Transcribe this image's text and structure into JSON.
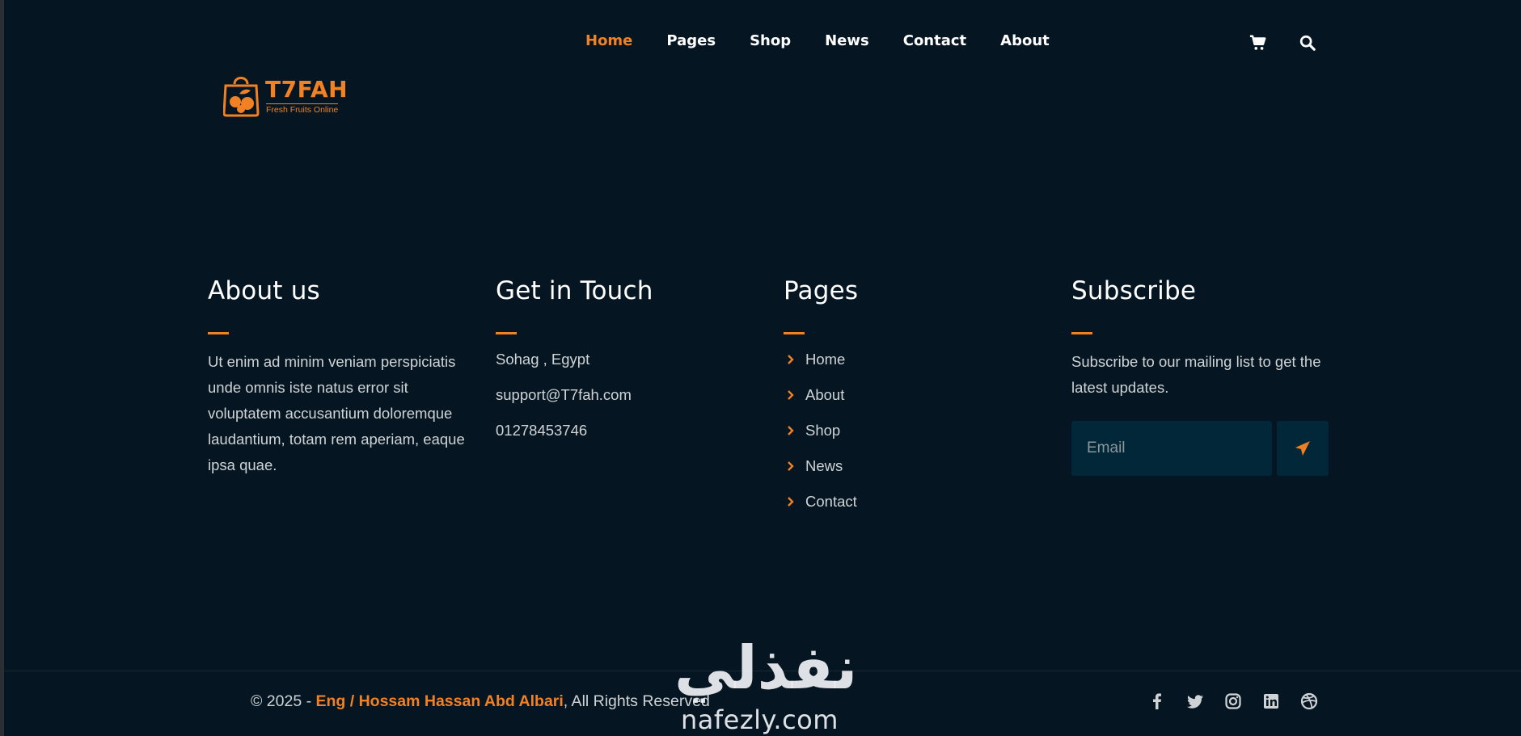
{
  "nav": {
    "items": [
      "Home",
      "Pages",
      "Shop",
      "News",
      "Contact",
      "About"
    ],
    "active": "Home",
    "cart_icon": "shopping-cart-icon",
    "search_icon": "search-icon"
  },
  "logo": {
    "name": "T7FAH",
    "tagline": "Fresh Fruits Online"
  },
  "about": {
    "title": "About us",
    "text": "Ut enim ad minim veniam perspiciatis unde omnis iste natus error sit voluptatem accusantium doloremque laudantium, totam rem aperiam, eaque ipsa quae."
  },
  "touch": {
    "title": "Get in Touch",
    "address": "Sohag , Egypt",
    "email": "support@T7fah.com",
    "phone": "01278453746"
  },
  "pages": {
    "title": "Pages",
    "links": [
      "Home",
      "About",
      "Shop",
      "News",
      "Contact"
    ]
  },
  "subscribe": {
    "title": "Subscribe",
    "text": "Subscribe to our mailing list to get the latest updates.",
    "placeholder": "Email",
    "button_icon": "send-icon"
  },
  "footer": {
    "prefix": "© 2025 - ",
    "author": "Eng / Hossam Hassan Abd Albari",
    "suffix": ", All Rights Reserved",
    "socials": [
      "facebook-icon",
      "twitter-icon",
      "instagram-icon",
      "linkedin-icon",
      "dribbble-icon"
    ]
  },
  "watermark": {
    "arabic": "نفذلي",
    "latin": "nafezly.com"
  },
  "colors": {
    "background": "#051622",
    "accent": "#F28123",
    "input": "#012738"
  }
}
